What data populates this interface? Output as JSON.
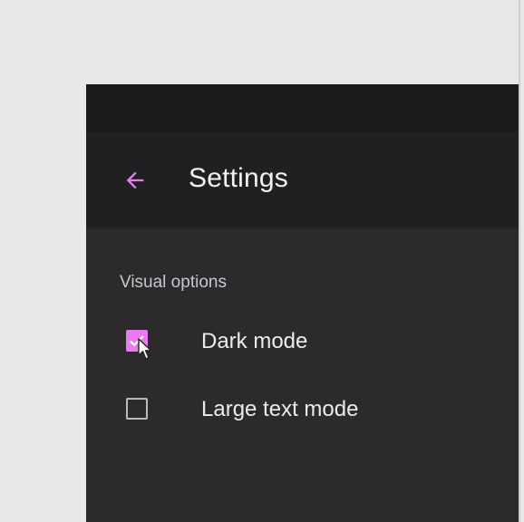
{
  "colors": {
    "accent": "#e97bf0",
    "app_bar": "#201f21",
    "background": "#2c2a2d",
    "status_bar": "#1b1a1c"
  },
  "app_bar": {
    "back_icon": "arrow-left-icon",
    "title": "Settings"
  },
  "section": {
    "header": "Visual options"
  },
  "options": [
    {
      "label": "Dark mode",
      "checked": true
    },
    {
      "label": "Large text mode",
      "checked": false
    }
  ]
}
